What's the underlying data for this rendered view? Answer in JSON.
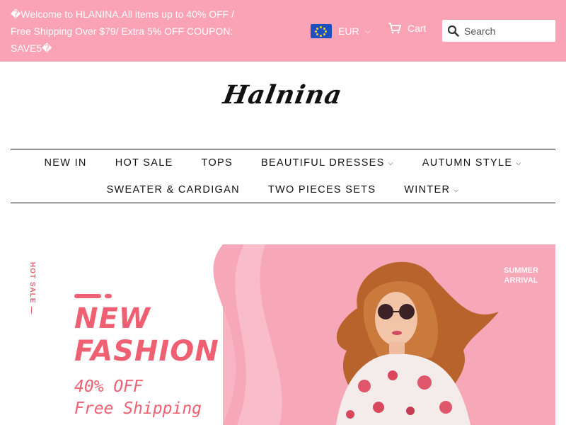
{
  "announcement": {
    "text": "�Welcome to HLANINA.All items up to 40% OFF / Free Shipping Over $79/ Extra 5% OFF COUPON: SAVE5�"
  },
  "currency": {
    "code": "EUR",
    "icon": "eu-flag-icon"
  },
  "cart": {
    "label": "Cart",
    "icon": "cart-icon"
  },
  "search": {
    "placeholder": "Search",
    "value": "",
    "icon": "search-icon"
  },
  "logo": {
    "text": "Halnina"
  },
  "nav": {
    "row1": [
      {
        "label": "NEW IN",
        "dropdown": false
      },
      {
        "label": "HOT SALE",
        "dropdown": false
      },
      {
        "label": "TOPS",
        "dropdown": false
      },
      {
        "label": "BEAUTIFUL DRESSES",
        "dropdown": true
      },
      {
        "label": "AUTUMN STYLE",
        "dropdown": true
      }
    ],
    "row2": [
      {
        "label": "SWEATER & CARDIGAN",
        "dropdown": false
      },
      {
        "label": "TWO PIECES SETS",
        "dropdown": false
      },
      {
        "label": "WINTER",
        "dropdown": true
      }
    ]
  },
  "hero": {
    "side_tag": "HOT SALE",
    "title_line1": "NEW",
    "title_line2": "FASHION",
    "sub_line1": "40% OFF",
    "sub_line2": "Free Shipping",
    "season_line1": "SUMMER",
    "season_line2": "ARRIVAL"
  },
  "colors": {
    "announcement_bg": "#f9a3b4",
    "accent": "#f06073",
    "hero_pink": "#f8b4c3"
  }
}
